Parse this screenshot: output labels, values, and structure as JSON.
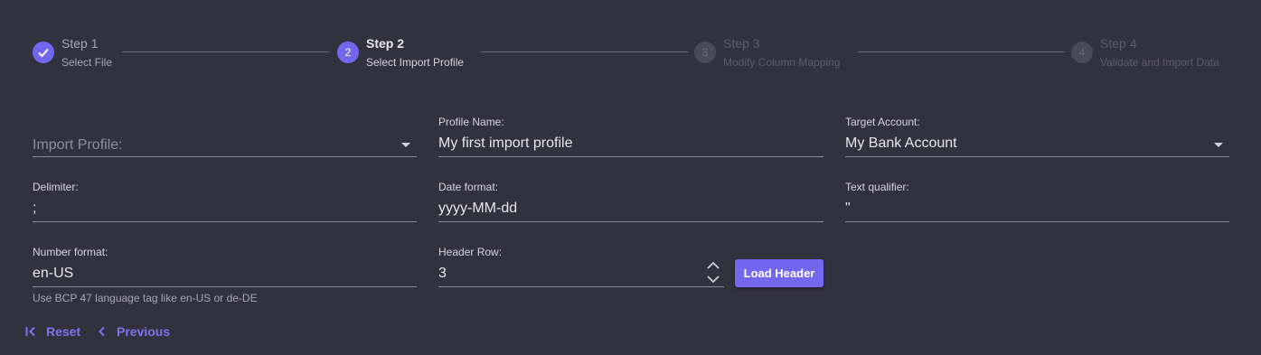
{
  "stepper": {
    "steps": [
      {
        "title": "Step 1",
        "subtitle": "Select File",
        "number": "1",
        "state": "done",
        "icon": "check-icon"
      },
      {
        "title": "Step 2",
        "subtitle": "Select Import Profile",
        "number": "2",
        "state": "current"
      },
      {
        "title": "Step 3",
        "subtitle": "Modify Column Mapping",
        "number": "3",
        "state": "future"
      },
      {
        "title": "Step 4",
        "subtitle": "Validate and Import Data",
        "number": "4",
        "state": "future"
      }
    ]
  },
  "form": {
    "import_profile": {
      "placeholder": "Import Profile:",
      "value": "",
      "icon": "chevron-down-icon"
    },
    "profile_name": {
      "label": "Profile Name:",
      "value": "My first import profile"
    },
    "target_account": {
      "label": "Target Account:",
      "value": "My Bank Account",
      "icon": "chevron-down-icon"
    },
    "delimiter": {
      "label": "Delimiter:",
      "value": ";"
    },
    "date_format": {
      "label": "Date format:",
      "value": "yyyy-MM-dd"
    },
    "text_qualifier": {
      "label": "Text qualifier:",
      "value": "\""
    },
    "number_format": {
      "label": "Number format:",
      "value": "en-US",
      "hint": "Use BCP 47 language tag like en-US or de-DE"
    },
    "header_row": {
      "label": "Header Row:",
      "value": "3"
    },
    "load_header_label": "Load Header"
  },
  "actions": {
    "reset_label": "Reset",
    "previous_label": "Previous"
  },
  "colors": {
    "background": "#32313e",
    "accent": "#7367f0",
    "text": "#e6e6ec",
    "muted": "#8e8d9b"
  }
}
